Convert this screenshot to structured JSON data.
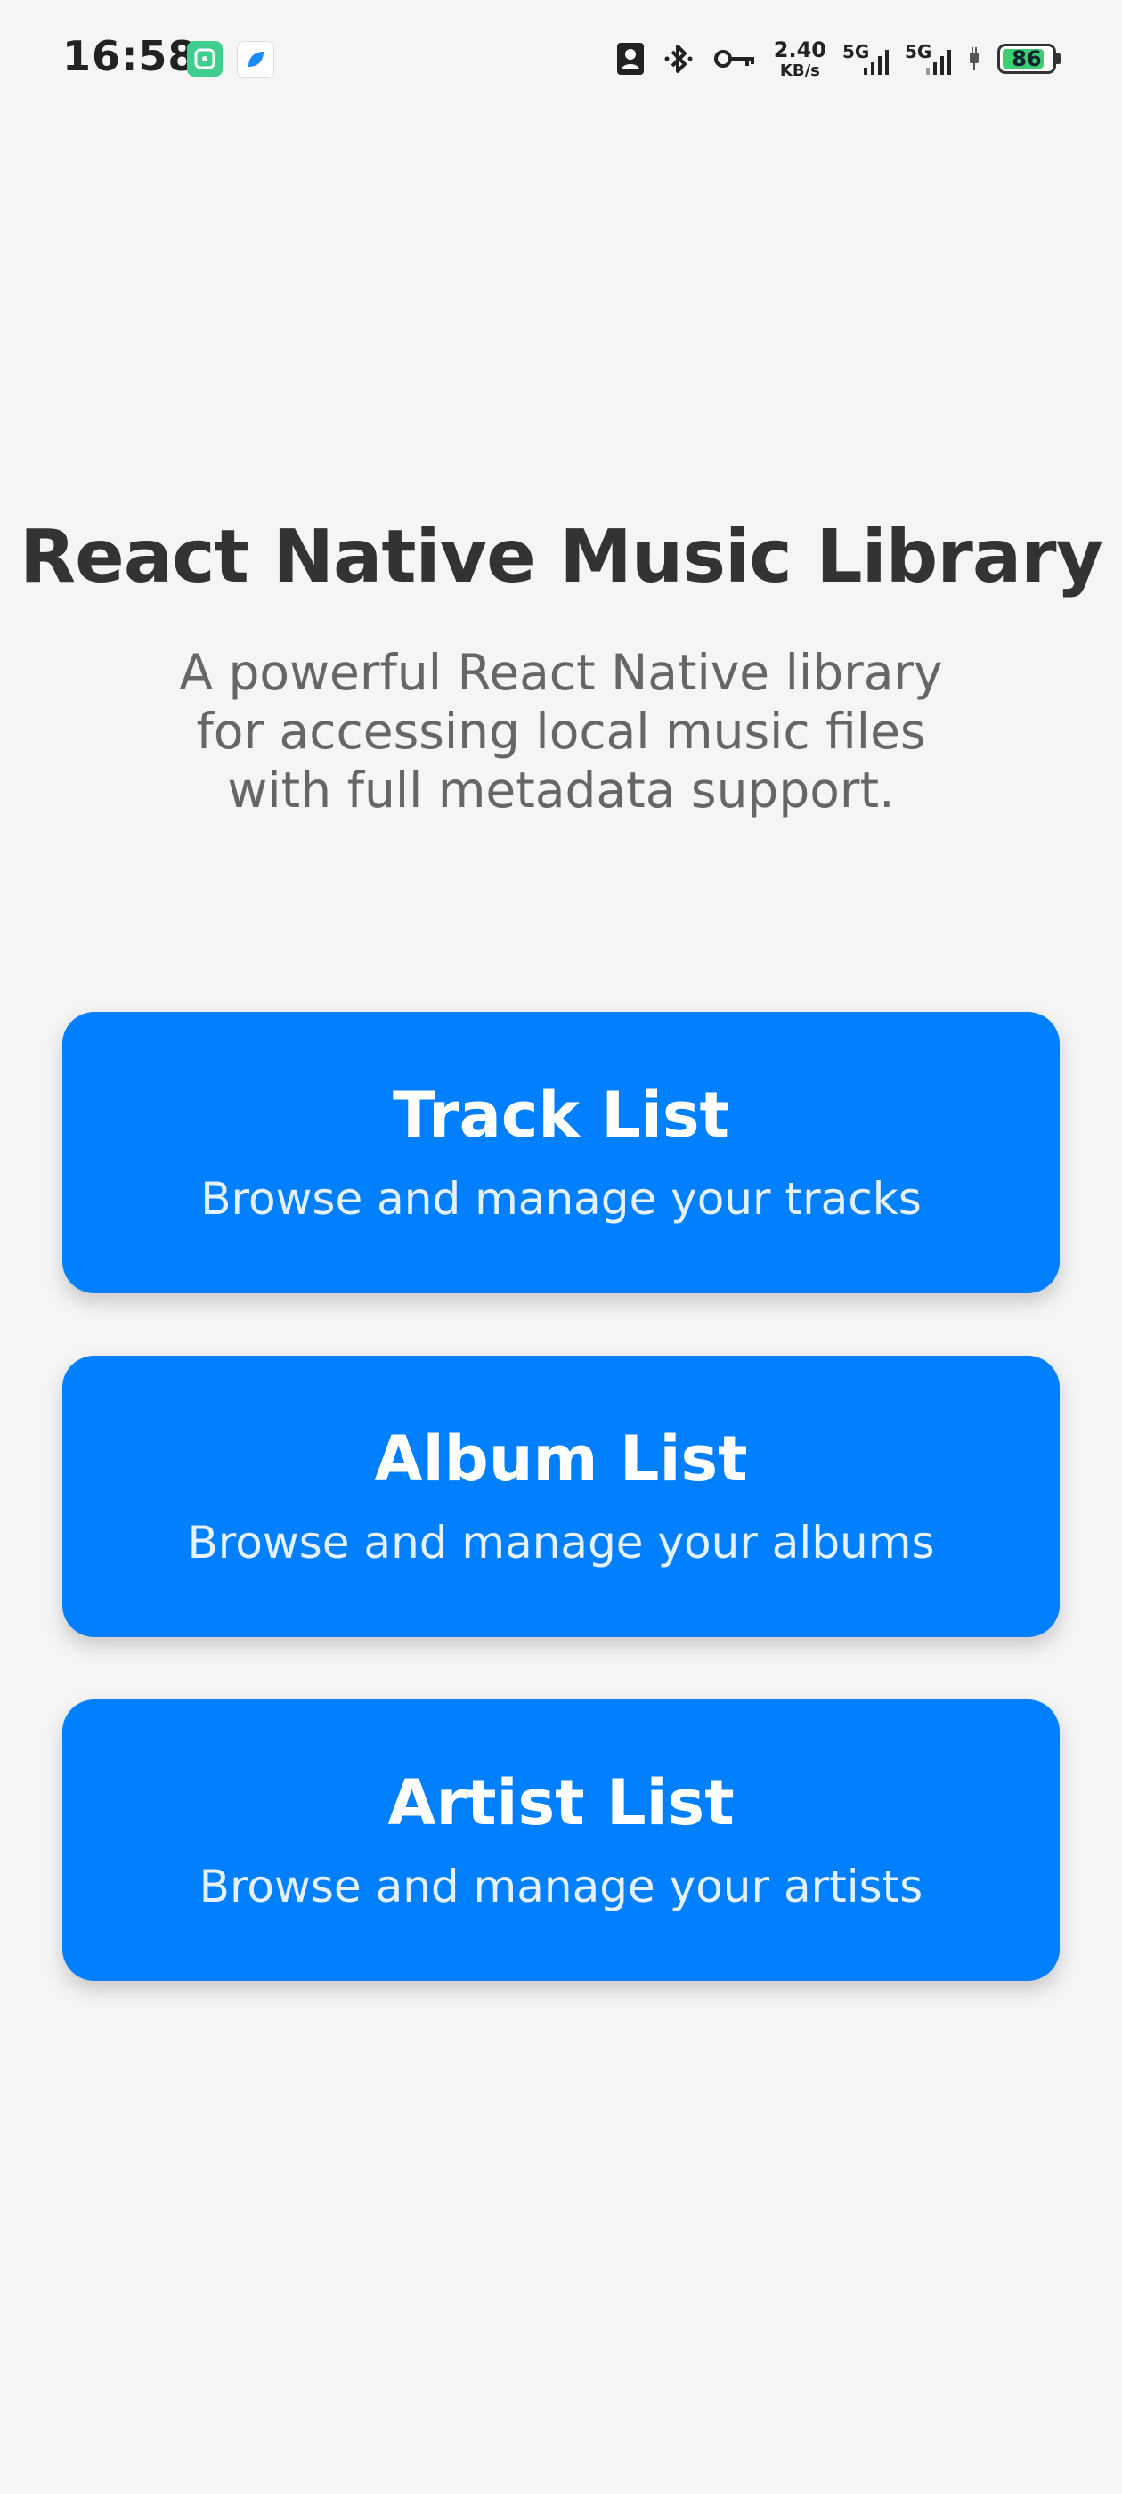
{
  "status_bar": {
    "time": "16:58",
    "net_speed_value": "2.40",
    "net_speed_unit": "KB/s",
    "signal_1_label": "5G",
    "signal_2_label": "5G",
    "battery_percent": "86",
    "battery_level": 0.86,
    "battery_color": "#3ccf72"
  },
  "header": {
    "title": "React Native Music Library",
    "subtitle": "A powerful React Native library for accessing local music files with full metadata support."
  },
  "menu": {
    "accent_color": "#0080ff",
    "items": [
      {
        "title": "Track List",
        "subtitle": "Browse and manage your tracks"
      },
      {
        "title": "Album List",
        "subtitle": "Browse and manage your albums"
      },
      {
        "title": "Artist List",
        "subtitle": "Browse and manage your artists"
      }
    ]
  }
}
